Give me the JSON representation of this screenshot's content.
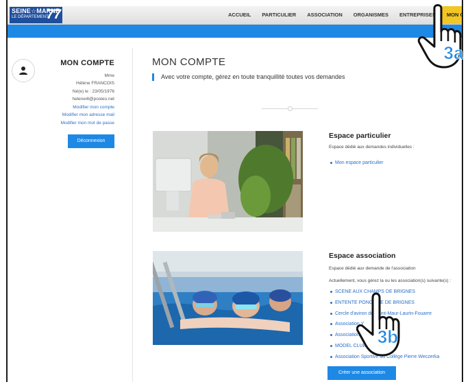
{
  "header": {
    "logo_line1": "SEINE☆MARNE",
    "logo_line2": "LE DÉPARTEMENT",
    "logo_number": "77",
    "nav": [
      "ACCUEIL",
      "PARTICULIER",
      "ASSOCIATION",
      "ORGANISMES",
      "ENTREPRISES",
      "MON COMPTE"
    ],
    "active_nav": "MON COMPTE",
    "active_nav_color": "#f2c623",
    "accent_color": "#1e88e5"
  },
  "sidebar": {
    "title": "MON COMPTE",
    "civility": "Mme",
    "name": "Hélène FRANCOIS",
    "birth": "Né(e) le : 23/05/1976",
    "email": "helene4l@posteo.net",
    "link_account": "Modifier mon compte",
    "link_email": "Modifier mon adresse mail",
    "link_password": "Modifier mon mot de passe",
    "logout": "Déconnexion",
    "avatar_icon": "person-icon"
  },
  "main": {
    "title": "MON COMPTE",
    "subtitle": "Avec votre compte, gérez en toute tranquillité toutes vos demandes",
    "particulier": {
      "title": "Espace particulier",
      "desc": "Espace dédié aux demandes individuelles :",
      "link": "Mon espace particulier"
    },
    "association": {
      "title": "Espace association",
      "desc": "Espace dédié aux demande de l'association",
      "desc2": "Actuellement, vous gérez la ou les association(s) suivante(s) :",
      "items": [
        "SCENE AUX CHAMPS DE BRIGNES",
        "ENTENTE PONGISTE DE BRIGNES",
        "Cercle d'aviron de Saint-Maur-Laurin-Fouarre",
        "Association Y",
        "Association Tessa",
        "MODEL CLUB LA SABLES",
        "Association Sportive du Collège Pierre Weczerka"
      ],
      "create": "Créer une association"
    }
  },
  "annotations": {
    "hand_a": "3a",
    "hand_b": "3b",
    "hand_icon": "pointing-hand-icon"
  }
}
